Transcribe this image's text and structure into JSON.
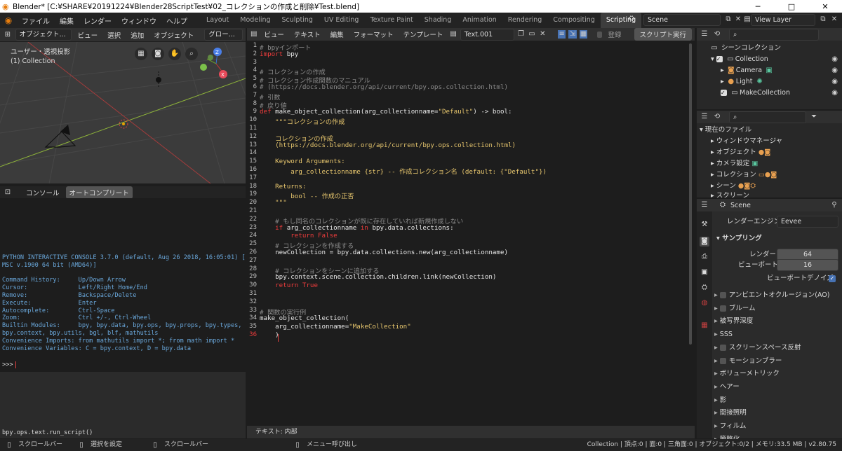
{
  "titlebar": {
    "title": "Blender* [C:¥SHARE¥20191224¥Blender28ScriptTest¥02_コレクションの作成と削除¥Test.blend]",
    "minimize": "─",
    "maximize": "□",
    "close": "✕"
  },
  "menu": [
    "ファイル",
    "編集",
    "レンダー",
    "ウィンドウ",
    "ヘルプ"
  ],
  "workspaces": [
    "Layout",
    "Modeling",
    "Sculpting",
    "UV Editing",
    "Texture Paint",
    "Shading",
    "Animation",
    "Rendering",
    "Compositing",
    "Scripting"
  ],
  "scene": "Scene",
  "view_layer": "View Layer",
  "viewport": {
    "mode": "オブジェクト...",
    "menus": [
      "ビュー",
      "選択",
      "追加",
      "オブジェクト"
    ],
    "transform": "グロー...",
    "view_name": "ユーザー・透視投影",
    "collection": "(1) Collection"
  },
  "console": {
    "tabs": [
      "コンソール",
      "オートコンプリート"
    ],
    "lines": [
      "PYTHON INTERACTIVE CONSOLE 3.7.0 (default, Aug 26 2018, 16:05:01) [",
      "MSC v.1900 64 bit (AMD64)]",
      "",
      "Command History:     Up/Down Arrow",
      "Cursor:              Left/Right Home/End",
      "Remove:              Backspace/Delete",
      "Execute:             Enter",
      "Autocomplete:        Ctrl-Space",
      "Zoom:                Ctrl +/-, Ctrl-Wheel",
      "Builtin Modules:     bpy, bpy.data, bpy.ops, bpy.props, bpy.types,",
      "bpy.context, bpy.utils, bgl, blf, mathutils",
      "Convenience Imports: from mathutils import *; from math import *",
      "Convenience Variables: C = bpy.context, D = bpy.data"
    ],
    "prompt": ">>> ",
    "last_op": "bpy.ops.text.run_script()"
  },
  "editor": {
    "menus": [
      "ビュー",
      "テキスト",
      "編集",
      "フォーマット",
      "テンプレート"
    ],
    "filename": "Text.001",
    "register": "登録",
    "run": "スクリプト実行",
    "footer": "テキスト: 内部"
  },
  "outliner": {
    "items": [
      "シーンコレクション",
      "Collection",
      "Camera",
      "Light",
      "MakeCollection"
    ]
  },
  "files": {
    "items": [
      "現在のファイル",
      "ウィンドウマネージャ",
      "オブジェクト",
      "カメラ設定",
      "コレクション",
      "シーン",
      "スクリーン"
    ]
  },
  "props": {
    "scene": "Scene",
    "engine_label": "レンダーエンジン",
    "engine": "Eevee",
    "sampling": "サンプリング",
    "render_label": "レンダー",
    "render_val": "64",
    "viewport_label": "ビューポート",
    "viewport_val": "16",
    "denoise": "ビューポートデノイズ",
    "sections": [
      "アンビエントオクルージョン(AO)",
      "ブルーム",
      "被写界深度",
      "SSS",
      "スクリーンスペース反射",
      "モーションブラー",
      "ボリューメトリック",
      "ヘアー",
      "影",
      "間接照明",
      "フィルム",
      "簡略化"
    ]
  },
  "status": {
    "a": "スクロールバー",
    "b": "選択を設定",
    "c": "スクロールバー",
    "d": "メニュー呼び出し",
    "info": "Collection | 頂点:0 | 面:0 | 三角面:0 | オブジェクト:0/2 | メモリ:33.5 MB | v2.80.75"
  },
  "colors": {
    "bg": "#1d1d1d",
    "panel": "#303030",
    "accent": "#4772b3",
    "keyword": "#ee3c3c",
    "string": "#e8c76e",
    "comment": "#8a8a8a"
  }
}
